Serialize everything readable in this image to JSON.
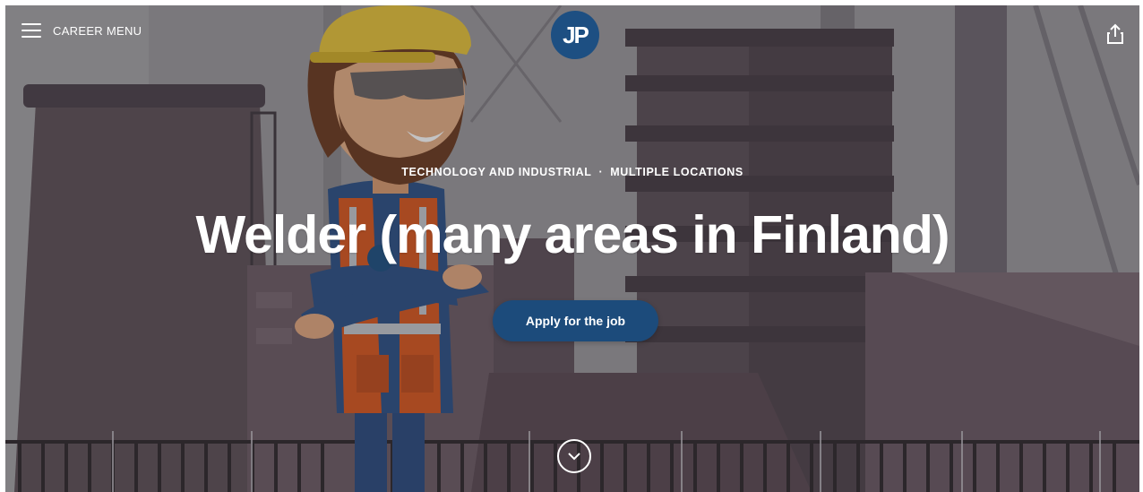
{
  "header": {
    "menu_label": "CAREER MENU",
    "logo_text": "JP",
    "share_icon": "share-icon"
  },
  "hero": {
    "category": "TECHNOLOGY AND INDUSTRIAL",
    "separator": "·",
    "location": "MULTIPLE LOCATIONS",
    "title": "Welder (many areas in Finland)",
    "apply_label": "Apply for the job",
    "scroll_icon": "chevron-down-circle-icon",
    "badge_text": "JP"
  },
  "colors": {
    "brand_blue": "#1d4f82",
    "button_blue": "#1c4b7b",
    "text": "#ffffff"
  }
}
